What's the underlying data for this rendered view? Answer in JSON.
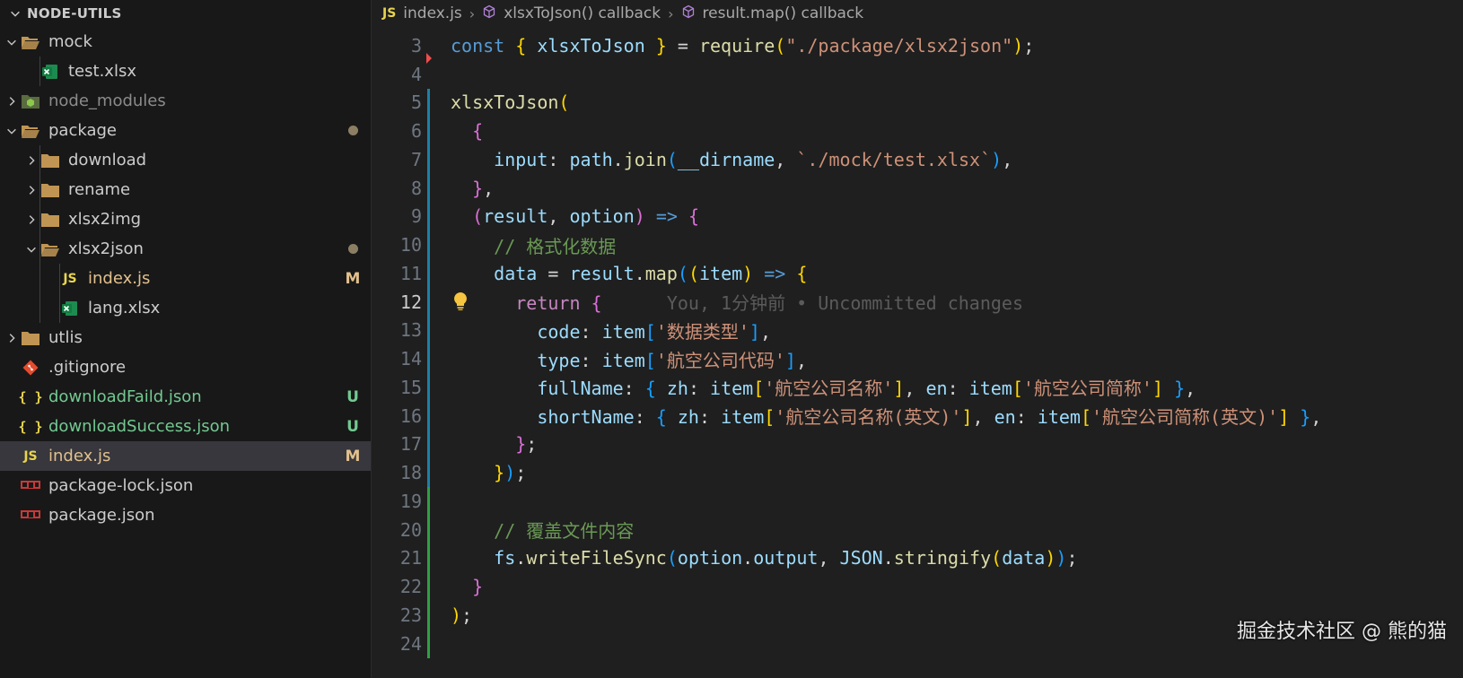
{
  "explorer": {
    "title": "NODE-UTILS",
    "items": [
      {
        "label": "mock",
        "type": "folder-open",
        "depth": 0,
        "dim": false
      },
      {
        "label": "test.xlsx",
        "type": "excel",
        "depth": 1,
        "dim": false
      },
      {
        "label": "node_modules",
        "type": "folder-node",
        "depth": 0,
        "dim": true
      },
      {
        "label": "package",
        "type": "folder-open",
        "depth": 0,
        "badge": "dot"
      },
      {
        "label": "download",
        "type": "folder",
        "depth": 1
      },
      {
        "label": "rename",
        "type": "folder",
        "depth": 1
      },
      {
        "label": "xlsx2img",
        "type": "folder",
        "depth": 1
      },
      {
        "label": "xlsx2json",
        "type": "folder-open",
        "depth": 1,
        "badge": "dot"
      },
      {
        "label": "index.js",
        "type": "js",
        "depth": 2,
        "badge": "M"
      },
      {
        "label": "lang.xlsx",
        "type": "excel",
        "depth": 2
      },
      {
        "label": "utlis",
        "type": "folder",
        "depth": 0
      },
      {
        "label": ".gitignore",
        "type": "git",
        "depth": 0
      },
      {
        "label": "downloadFaild.json",
        "type": "json",
        "depth": 0,
        "badge": "U"
      },
      {
        "label": "downloadSuccess.json",
        "type": "json",
        "depth": 0,
        "badge": "U"
      },
      {
        "label": "index.js",
        "type": "js",
        "depth": 0,
        "badge": "M",
        "selected": true
      },
      {
        "label": "package-lock.json",
        "type": "npm",
        "depth": 0
      },
      {
        "label": "package.json",
        "type": "npm",
        "depth": 0
      }
    ]
  },
  "breadcrumbs": {
    "file": "index.js",
    "file_icon": "JS",
    "symbol1": "xlsxToJson() callback",
    "symbol2": "result.map() callback"
  },
  "editor": {
    "active_line": 12,
    "blame": "You, 1分钟前 • Uncommitted changes",
    "lines": [
      {
        "n": "3",
        "tokens": [
          [
            "kw",
            "const "
          ],
          [
            "b1",
            "{ "
          ],
          [
            "vr",
            "xlsxToJson "
          ],
          [
            "b1",
            "}"
          ],
          [
            "op",
            " = "
          ],
          [
            "fn",
            "require"
          ],
          [
            "b1",
            "("
          ],
          [
            "st",
            "\"./package/xlsx2json\""
          ],
          [
            "b1",
            ")"
          ],
          [
            "op",
            ";"
          ]
        ]
      },
      {
        "n": "4",
        "tokens": []
      },
      {
        "n": "5",
        "tokens": [
          [
            "fn",
            "xlsxToJson"
          ],
          [
            "b1",
            "("
          ]
        ]
      },
      {
        "n": "6",
        "tokens": [
          [
            "op",
            "  "
          ],
          [
            "b2",
            "{"
          ]
        ]
      },
      {
        "n": "7",
        "tokens": [
          [
            "op",
            "    "
          ],
          [
            "vr",
            "input"
          ],
          [
            "op",
            ": "
          ],
          [
            "vr",
            "path"
          ],
          [
            "op",
            "."
          ],
          [
            "fn",
            "join"
          ],
          [
            "b3",
            "("
          ],
          [
            "vr",
            "__dirname"
          ],
          [
            "op",
            ", "
          ],
          [
            "st",
            "`./mock/test.xlsx`"
          ],
          [
            "b3",
            ")"
          ],
          [
            "op",
            ","
          ]
        ]
      },
      {
        "n": "8",
        "tokens": [
          [
            "op",
            "  "
          ],
          [
            "b2",
            "}"
          ],
          [
            "op",
            ","
          ]
        ]
      },
      {
        "n": "9",
        "tokens": [
          [
            "op",
            "  "
          ],
          [
            "b2",
            "("
          ],
          [
            "vr",
            "result"
          ],
          [
            "op",
            ", "
          ],
          [
            "vr",
            "option"
          ],
          [
            "b2",
            ")"
          ],
          [
            "op",
            " "
          ],
          [
            "kw",
            "=>"
          ],
          [
            "op",
            " "
          ],
          [
            "b2",
            "{"
          ]
        ]
      },
      {
        "n": "10",
        "tokens": [
          [
            "op",
            "    "
          ],
          [
            "cm",
            "// 格式化数据"
          ]
        ]
      },
      {
        "n": "11",
        "tokens": [
          [
            "op",
            "    "
          ],
          [
            "vr",
            "data"
          ],
          [
            "op",
            " = "
          ],
          [
            "vr",
            "result"
          ],
          [
            "op",
            "."
          ],
          [
            "fn",
            "map"
          ],
          [
            "b3",
            "("
          ],
          [
            "b1",
            "("
          ],
          [
            "vr",
            "item"
          ],
          [
            "b1",
            ")"
          ],
          [
            "op",
            " "
          ],
          [
            "kw",
            "=>"
          ],
          [
            "op",
            " "
          ],
          [
            "b1",
            "{"
          ]
        ]
      },
      {
        "n": "12",
        "tokens": [
          [
            "op",
            "      "
          ],
          [
            "kc",
            "return"
          ],
          [
            "op",
            " "
          ],
          [
            "b2",
            "{"
          ],
          [
            "blame",
            "      You, 1分钟前 • Uncommitted changes"
          ]
        ]
      },
      {
        "n": "13",
        "tokens": [
          [
            "op",
            "        "
          ],
          [
            "vr",
            "code"
          ],
          [
            "op",
            ": "
          ],
          [
            "vr",
            "item"
          ],
          [
            "b3",
            "["
          ],
          [
            "st",
            "'数据类型'"
          ],
          [
            "b3",
            "]"
          ],
          [
            "op",
            ","
          ]
        ]
      },
      {
        "n": "14",
        "tokens": [
          [
            "op",
            "        "
          ],
          [
            "vr",
            "type"
          ],
          [
            "op",
            ": "
          ],
          [
            "vr",
            "item"
          ],
          [
            "b3",
            "["
          ],
          [
            "st",
            "'航空公司代码'"
          ],
          [
            "b3",
            "]"
          ],
          [
            "op",
            ","
          ]
        ]
      },
      {
        "n": "15",
        "tokens": [
          [
            "op",
            "        "
          ],
          [
            "vr",
            "fullName"
          ],
          [
            "op",
            ": "
          ],
          [
            "b3",
            "{ "
          ],
          [
            "vr",
            "zh"
          ],
          [
            "op",
            ": "
          ],
          [
            "vr",
            "item"
          ],
          [
            "b1",
            "["
          ],
          [
            "st",
            "'航空公司名称'"
          ],
          [
            "b1",
            "]"
          ],
          [
            "op",
            ", "
          ],
          [
            "vr",
            "en"
          ],
          [
            "op",
            ": "
          ],
          [
            "vr",
            "item"
          ],
          [
            "b1",
            "["
          ],
          [
            "st",
            "'航空公司简称'"
          ],
          [
            "b1",
            "]"
          ],
          [
            "b3",
            " }"
          ],
          [
            "op",
            ","
          ]
        ]
      },
      {
        "n": "16",
        "tokens": [
          [
            "op",
            "        "
          ],
          [
            "vr",
            "shortName"
          ],
          [
            "op",
            ": "
          ],
          [
            "b3",
            "{ "
          ],
          [
            "vr",
            "zh"
          ],
          [
            "op",
            ": "
          ],
          [
            "vr",
            "item"
          ],
          [
            "b1",
            "["
          ],
          [
            "st",
            "'航空公司名称(英文)'"
          ],
          [
            "b1",
            "]"
          ],
          [
            "op",
            ", "
          ],
          [
            "vr",
            "en"
          ],
          [
            "op",
            ": "
          ],
          [
            "vr",
            "item"
          ],
          [
            "b1",
            "["
          ],
          [
            "st",
            "'航空公司简称(英文)'"
          ],
          [
            "b1",
            "]"
          ],
          [
            "b3",
            " }"
          ],
          [
            "op",
            ","
          ]
        ]
      },
      {
        "n": "17",
        "tokens": [
          [
            "op",
            "      "
          ],
          [
            "b2",
            "}"
          ],
          [
            "op",
            ";"
          ]
        ]
      },
      {
        "n": "18",
        "tokens": [
          [
            "op",
            "    "
          ],
          [
            "b1",
            "}"
          ],
          [
            "b3",
            ")"
          ],
          [
            "op",
            ";"
          ]
        ]
      },
      {
        "n": "19",
        "tokens": []
      },
      {
        "n": "20",
        "tokens": [
          [
            "op",
            "    "
          ],
          [
            "cm",
            "// 覆盖文件内容"
          ]
        ]
      },
      {
        "n": "21",
        "tokens": [
          [
            "op",
            "    "
          ],
          [
            "vr",
            "fs"
          ],
          [
            "op",
            "."
          ],
          [
            "fn",
            "writeFileSync"
          ],
          [
            "b3",
            "("
          ],
          [
            "vr",
            "option"
          ],
          [
            "op",
            "."
          ],
          [
            "vr",
            "output"
          ],
          [
            "op",
            ", "
          ],
          [
            "vr",
            "JSON"
          ],
          [
            "op",
            "."
          ],
          [
            "fn",
            "stringify"
          ],
          [
            "b1",
            "("
          ],
          [
            "vr",
            "data"
          ],
          [
            "b1",
            ")"
          ],
          [
            "b3",
            ")"
          ],
          [
            "op",
            ";"
          ]
        ]
      },
      {
        "n": "22",
        "tokens": [
          [
            "op",
            "  "
          ],
          [
            "b2",
            "}"
          ]
        ]
      },
      {
        "n": "23",
        "tokens": [
          [
            "b1",
            ")"
          ],
          [
            "op",
            ";"
          ]
        ]
      },
      {
        "n": "24",
        "tokens": []
      }
    ],
    "gutter": {
      "3": "del",
      "5": "mod",
      "6": "mod",
      "7": "mod",
      "8": "mod",
      "9": "mod",
      "10": "mod",
      "11": "mod",
      "12": "mod",
      "13": "mod",
      "14": "mod",
      "15": "mod",
      "16": "mod",
      "17": "mod",
      "18": "mod",
      "19": "add",
      "20": "add",
      "21": "add",
      "22": "add",
      "23": "add",
      "24": "add"
    }
  },
  "watermark": "掘金技术社区 @ 熊的猫",
  "icons": {
    "chevron_down": "chevron-down-icon",
    "chevron_right": "chevron-right-icon",
    "lightbulb": "lightbulb-icon",
    "symbol": "method-cube-icon"
  },
  "colors": {
    "modified": "#e2c08d",
    "untracked": "#73c991",
    "gutter_modified": "#1b81a8",
    "gutter_added": "#2ea043"
  }
}
